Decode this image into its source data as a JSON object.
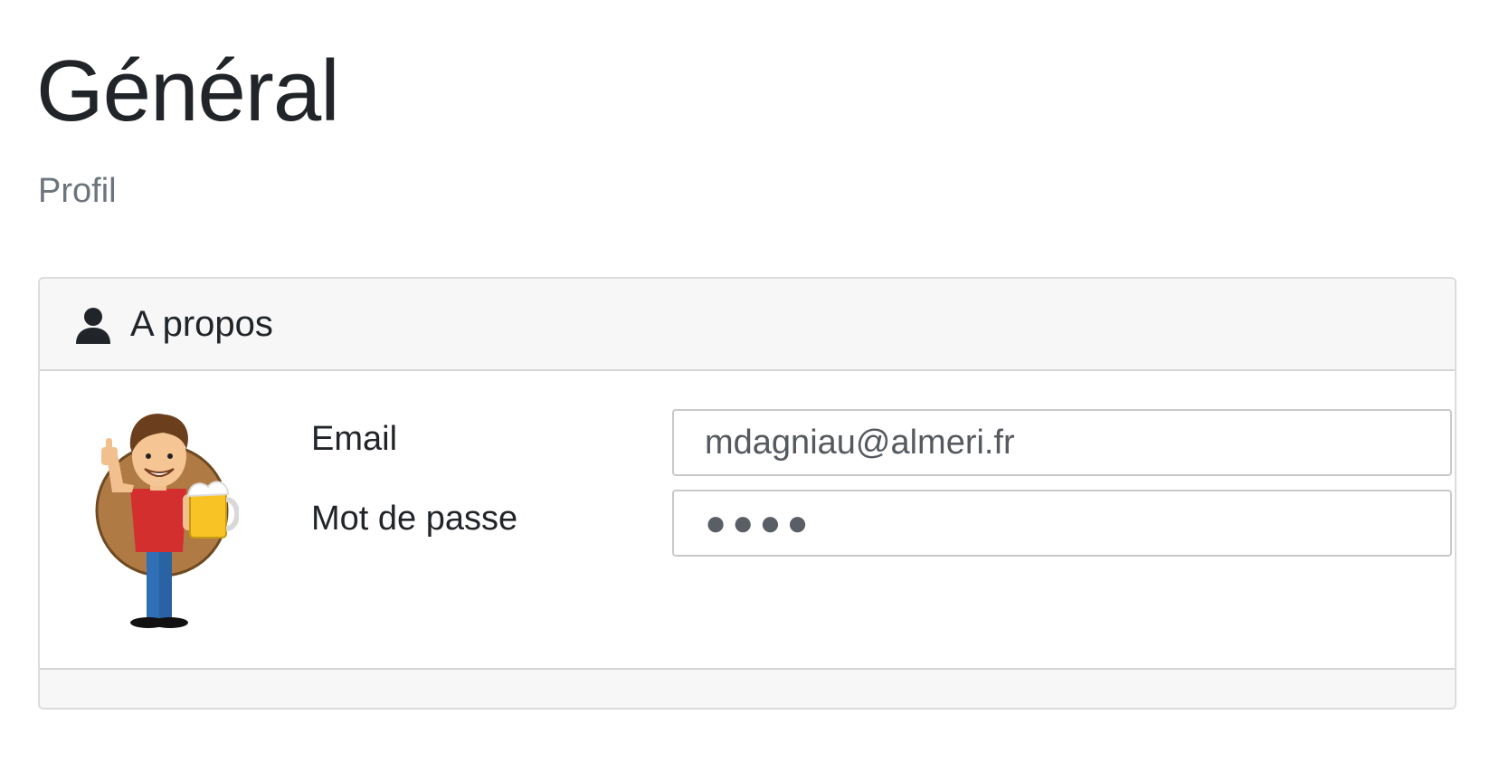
{
  "page": {
    "title": "Général",
    "subtitle": "Profil"
  },
  "card": {
    "header_icon": "user-icon",
    "header_label": "A propos",
    "avatar_icon": "cartoon-man-with-beer-avatar"
  },
  "form": {
    "email_label": "Email",
    "email_value": "mdagniau@almeri.fr",
    "password_label": "Mot de passe",
    "password_value": "●●●●"
  }
}
